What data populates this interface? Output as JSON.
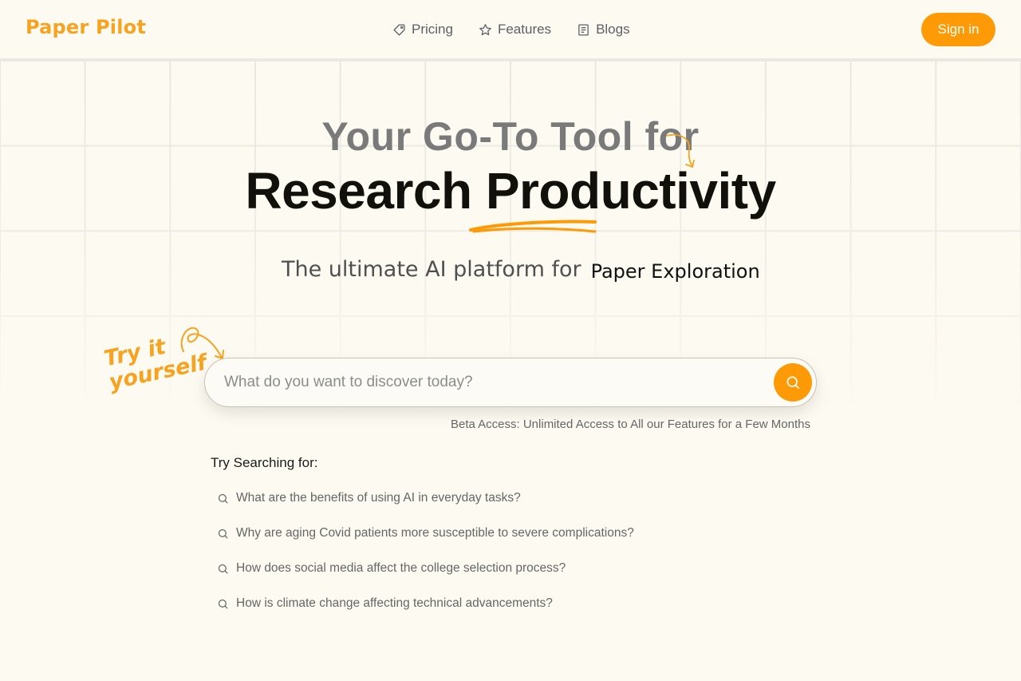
{
  "header": {
    "logo": "Paper Pilot",
    "nav": [
      {
        "label": "Pricing",
        "icon": "tag-icon"
      },
      {
        "label": "Features",
        "icon": "star-icon"
      },
      {
        "label": "Blogs",
        "icon": "document-icon"
      }
    ],
    "signin_label": "Sign in"
  },
  "hero": {
    "line1": "Your Go-To Tool for",
    "line2": "Research Productivity",
    "subtitle_static": "The ultimate AI platform for",
    "subtitle_typed": "Paper Exploration",
    "try_line1": "Try it",
    "try_line2": "yourself"
  },
  "search": {
    "placeholder": "What do you want to discover today?",
    "value": "",
    "beta_note": "Beta Access: Unlimited Access to All our Features for a Few Months"
  },
  "suggestions": {
    "title": "Try Searching for:",
    "items": [
      "What are the benefits of using AI in everyday tasks?",
      "Why are aging Covid patients more susceptible to severe complications?",
      "How does social media affect the college selection process?",
      "How is climate change affecting technical advancements?"
    ]
  },
  "colors": {
    "accent": "#fe9a05",
    "logo": "#f6a321",
    "background": "#fdfaf1"
  }
}
